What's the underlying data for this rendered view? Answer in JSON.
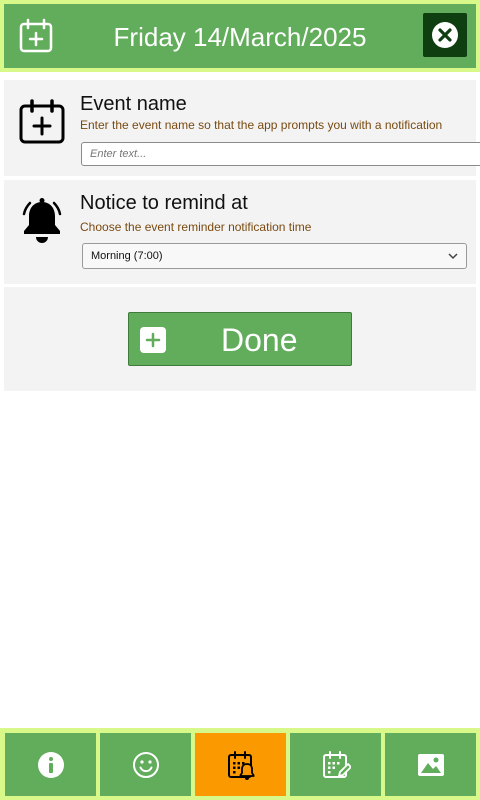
{
  "header": {
    "title": "Friday 14/March/2025",
    "calendar_icon": "calendar-plus-icon",
    "close_icon": "close-icon"
  },
  "event_card": {
    "icon": "calendar-plus-icon",
    "title": "Event name",
    "description": "Enter the event name so that the app prompts you with a notification",
    "input_placeholder": "Enter text...",
    "input_value": ""
  },
  "notice_card": {
    "icon": "bell-icon",
    "title": "Notice to remind at",
    "description": "Choose the event reminder notification time",
    "selected_option": "Morning (7:00)"
  },
  "done_button": {
    "label": "Done",
    "icon": "plus-icon"
  },
  "footer": {
    "tabs": [
      {
        "icon": "info-icon",
        "active": false
      },
      {
        "icon": "smiley-icon",
        "active": false
      },
      {
        "icon": "calendar-bell-icon",
        "active": true
      },
      {
        "icon": "calendar-edit-icon",
        "active": false
      },
      {
        "icon": "image-icon",
        "active": false
      }
    ]
  },
  "colors": {
    "primary_green": "#62ad5b",
    "accent_lime": "#d8f98a",
    "active_tab": "#fb9a00",
    "close_button": "#0f3e10",
    "card_background": "#f3f3f3",
    "description_text": "#7a4a10"
  }
}
